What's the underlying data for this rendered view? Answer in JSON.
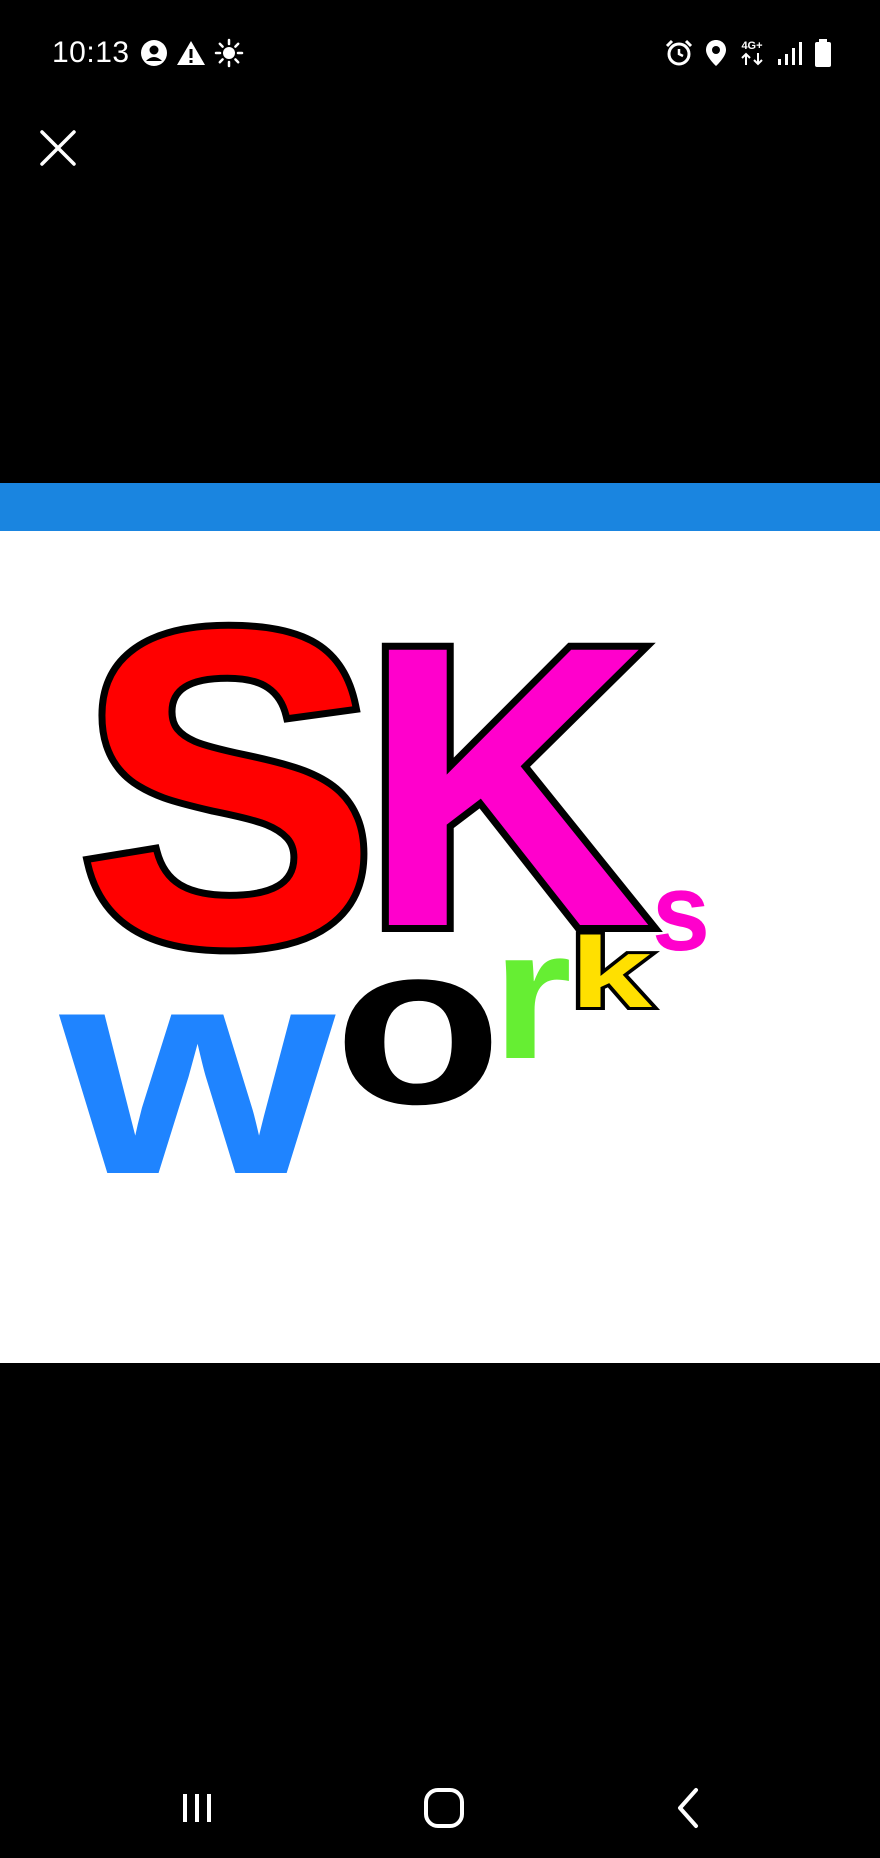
{
  "status_bar": {
    "time": "10:13",
    "left_icons": [
      "account-icon",
      "warning-icon",
      "brightness-icon"
    ],
    "right_icons": [
      "alarm-icon",
      "location-icon",
      "network-icon",
      "signal-icon",
      "battery-icon"
    ],
    "network_label": "4G+"
  },
  "viewer": {
    "logo": {
      "letters_main": [
        "S",
        "K"
      ],
      "letters_sub": [
        "w",
        "o",
        "r",
        "k",
        "s"
      ],
      "colors": {
        "S": "#ff0000",
        "K": "#ff00cc",
        "w": "#1f84ff",
        "o": "#000000",
        "r": "#66ee33",
        "k": "#ffe000",
        "s": "#ff00cc",
        "strip": "#1a85e0"
      }
    }
  },
  "nav_bar": {
    "buttons": [
      "recents-button",
      "home-button",
      "back-button"
    ]
  }
}
